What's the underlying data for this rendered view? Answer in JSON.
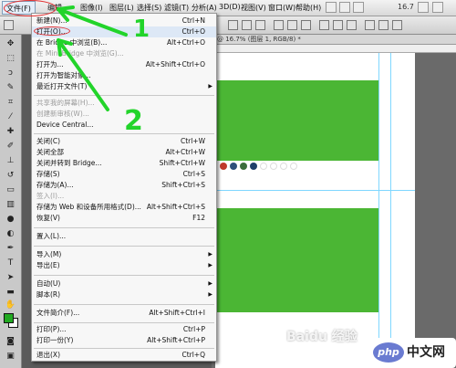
{
  "menubar": {
    "file": "文件(F)",
    "items": [
      {
        "name": "menu-edit",
        "label": "编辑"
      },
      {
        "name": "menu-image",
        "label": "图像(I)"
      },
      {
        "name": "menu-layer",
        "label": "图层(L)"
      },
      {
        "name": "menu-select",
        "label": "选择(S)"
      },
      {
        "name": "menu-filter",
        "label": "滤镜(T)"
      },
      {
        "name": "menu-analysis",
        "label": "分析(A)"
      },
      {
        "name": "menu-3d",
        "label": "3D(D)"
      },
      {
        "name": "menu-view",
        "label": "视图(V)"
      },
      {
        "name": "menu-window",
        "label": "窗口(W)"
      },
      {
        "name": "menu-help",
        "label": "帮助(H)"
      }
    ],
    "zoom": "16.7"
  },
  "document": {
    "tab": "@ 16.7% (图层 1, RGB/8) *"
  },
  "file_menu": {
    "items": [
      {
        "label": "新建(N)...",
        "shortcut": "Ctrl+N"
      },
      {
        "label": "打开(O)...",
        "shortcut": "Ctrl+O"
      },
      {
        "label": "在 Bridge 中浏览(B)...",
        "shortcut": "Alt+Ctrl+O"
      },
      {
        "label": "在 Mini Bridge 中浏览(G)..."
      },
      {
        "label": "打开为...",
        "shortcut": "Alt+Shift+Ctrl+O"
      },
      {
        "label": "打开为智能对象..."
      },
      {
        "label": "最近打开文件(T)"
      },
      {
        "label": "共享我的屏幕(H)..."
      },
      {
        "label": "创建新审核(W)..."
      },
      {
        "label": "Device Central..."
      },
      {
        "label": "关闭(C)",
        "shortcut": "Ctrl+W"
      },
      {
        "label": "关闭全部",
        "shortcut": "Alt+Ctrl+W"
      },
      {
        "label": "关闭并转到 Bridge...",
        "shortcut": "Shift+Ctrl+W"
      },
      {
        "label": "存储(S)",
        "shortcut": "Ctrl+S"
      },
      {
        "label": "存储为(A)...",
        "shortcut": "Shift+Ctrl+S"
      },
      {
        "label": "签入(I)..."
      },
      {
        "label": "存储为 Web 和设备所用格式(D)...",
        "shortcut": "Alt+Shift+Ctrl+S"
      },
      {
        "label": "恢复(V)",
        "shortcut": "F12"
      },
      {
        "label": "置入(L)..."
      },
      {
        "label": "导入(M)"
      },
      {
        "label": "导出(E)"
      },
      {
        "label": "自动(U)"
      },
      {
        "label": "脚本(R)"
      },
      {
        "label": "文件简介(F)...",
        "shortcut": "Alt+Shift+Ctrl+I"
      },
      {
        "label": "打印(P)...",
        "shortcut": "Ctrl+P"
      },
      {
        "label": "打印一份(Y)",
        "shortcut": "Alt+Shift+Ctrl+P"
      },
      {
        "label": "退出(X)",
        "shortcut": "Ctrl+Q"
      }
    ]
  },
  "annotations": {
    "step1": "1",
    "step2": "2"
  },
  "watermark": {
    "baidu": "Baidu 经验",
    "php_badge": "php",
    "php_text": "中文网"
  },
  "colors": {
    "green": "#4bb634",
    "annotation_green": "#22d42a",
    "annotation_red": "#e23030"
  }
}
